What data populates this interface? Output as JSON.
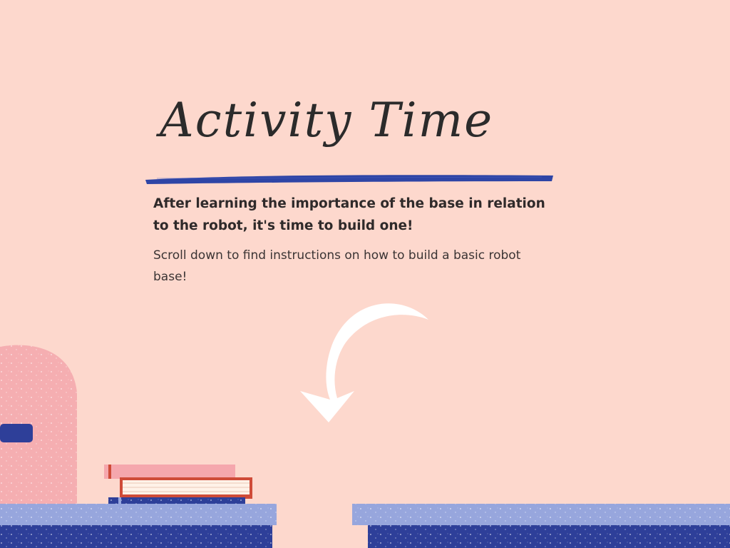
{
  "heading": "Activity Time",
  "lead": "After learning the importance of the base in relation to the robot, it's time to build one!",
  "instructions": "Scroll down to find instructions on how to build a basic robot base!",
  "colors": {
    "background": "#fdd8cd",
    "brush_underline": "#2e45a6",
    "arrow": "#ffffff",
    "shelf_light": "#97a6dd",
    "shelf_dark": "#2e3f99",
    "arch": "#f5aeb1"
  },
  "icons": [
    "curved-arrow-down-icon",
    "book-stack-icon",
    "arch-icon"
  ]
}
